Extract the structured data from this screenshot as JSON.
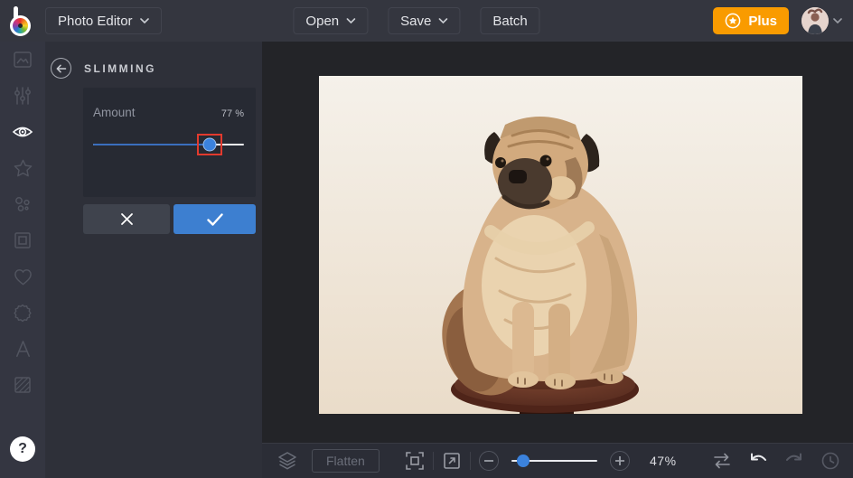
{
  "topbar": {
    "app_menu_label": "Photo Editor",
    "open_label": "Open",
    "save_label": "Save",
    "batch_label": "Batch",
    "plus_label": "Plus"
  },
  "sidebar": {
    "items": [
      {
        "name": "edit",
        "icon": "image-icon"
      },
      {
        "name": "adjust",
        "icon": "sliders-icon"
      },
      {
        "name": "touch-up",
        "icon": "eye-icon",
        "active": true
      },
      {
        "name": "effects",
        "icon": "star-icon"
      },
      {
        "name": "artsy",
        "icon": "bubbles-icon"
      },
      {
        "name": "frames",
        "icon": "frame-icon"
      },
      {
        "name": "graphics",
        "icon": "heart-icon"
      },
      {
        "name": "overlays",
        "icon": "badge-icon"
      },
      {
        "name": "text",
        "icon": "letter-a-icon"
      },
      {
        "name": "textures",
        "icon": "texture-icon"
      }
    ],
    "help_label": "?"
  },
  "panel": {
    "title": "SLIMMING",
    "amount": {
      "label": "Amount",
      "value": "77 %",
      "percent": 77
    }
  },
  "canvas": {
    "subject": "pug dog sitting on wooden stool, cream background"
  },
  "bottombar": {
    "flatten_label": "Flatten",
    "zoom_value": "47%",
    "zoom_slider_percent": 14
  },
  "colors": {
    "accent_blue": "#3b82dd",
    "accent_orange": "#f99b00",
    "highlight_red": "#e23a2e"
  }
}
